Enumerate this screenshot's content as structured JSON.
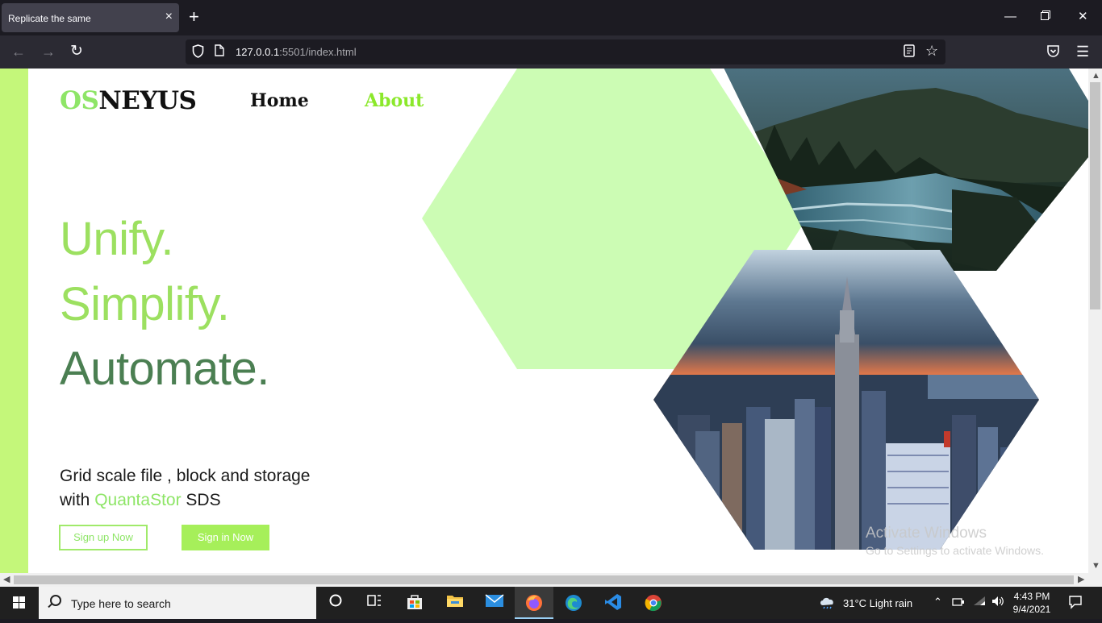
{
  "browser": {
    "tab_title": "Replicate the same",
    "tab_close": "×",
    "new_tab": "+",
    "url_host": "127.0.0.1",
    "url_rest": ":5501/index.html",
    "back_icon": "arrow-left-icon",
    "forward_icon": "arrow-right-icon",
    "reload_icon": "reload-icon"
  },
  "page": {
    "logo_part1": "OS",
    "logo_part2": "NEYUS",
    "nav": {
      "home": "Home",
      "about": "About"
    },
    "hero": {
      "line1": "Unify.",
      "line2": "Simplify.",
      "line3": "Automate."
    },
    "tagline_line1": "Grid scale file , block and storage",
    "tagline_with": "with ",
    "tagline_accent": "QuantaStor",
    "tagline_end": " SDS",
    "signup_button": "Sign up Now",
    "signin_button": "Sign in Now",
    "colors": {
      "accent_green": "#8ee567",
      "hex_fill": "#ccfcb4",
      "sidebar": "#c4f77a",
      "dark_green": "#4b7f52"
    }
  },
  "watermark": {
    "line1": "Activate Windows",
    "line2": "Go to Settings to activate Windows."
  },
  "taskbar": {
    "search_placeholder": "Type here to search",
    "weather": "31°C  Light rain",
    "time": "4:43 PM",
    "date": "9/4/2021"
  }
}
